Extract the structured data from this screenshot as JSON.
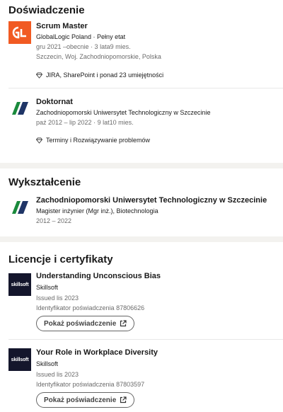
{
  "experience": {
    "title": "Doświadczenie",
    "items": [
      {
        "logo": "globallogic-logo",
        "role": "Scrum Master",
        "company": "GlobalLogic Poland · Pełny etat",
        "dates": "gru 2021 –obecnie · 3 lata9 mies.",
        "location": "Szczecin, Woj. Zachodniopomorskie, Polska",
        "skills": "JIRA, SharePoint i ponad 23 umiejętności"
      },
      {
        "logo": "zut-logo",
        "role": "Doktornat",
        "company": "Zachodniopomorski Uniwersytet Technologiczny w Szczecinie",
        "dates": "paź 2012 – lip 2022 · 9 lat10 mies.",
        "skills": "Terminy i Rozwiązywanie problemów"
      }
    ]
  },
  "education": {
    "title": "Wykształcenie",
    "items": [
      {
        "school": "Zachodniopomorski Uniwersytet Technologiczny w Szczecinie",
        "degree": "Magister inżynier (Mgr inż.), Biotechnologia",
        "dates": "2012 – 2022"
      }
    ]
  },
  "licenses": {
    "title": "Licencje i certyfikaty",
    "items": [
      {
        "logo_text": "skillsoft",
        "name": "Understanding Unconscious Bias",
        "issuer": "Skillsoft",
        "issued": "Issued lis 2023",
        "credential_id": "Identyfikator poświadczenia 87806626",
        "button_label": "Pokaż poświadczenie"
      },
      {
        "logo_text": "skillsoft",
        "name": "Your Role in Workplace Diversity",
        "issuer": "Skillsoft",
        "issued": "Issued lis 2023",
        "credential_id": "Identyfikator poświadczenia 87803597",
        "button_label": "Pokaż poświadczenie"
      }
    ]
  },
  "colors": {
    "globallogic_orange": "#f15a22",
    "zut_green": "#1a8a3c",
    "zut_navy": "#1f3566",
    "skillsoft_bg": "#14162c"
  },
  "icons": [
    "diamond-icon",
    "external-link-icon"
  ]
}
